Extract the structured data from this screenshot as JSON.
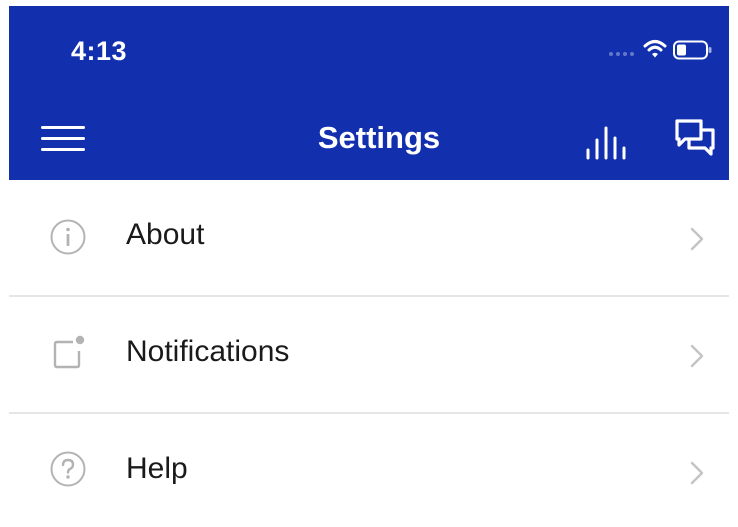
{
  "status_bar": {
    "time": "4:13",
    "signal_icon": "signal-dots-icon",
    "wifi_icon": "wifi-icon",
    "battery_icon": "battery-icon",
    "battery_level": 0.35
  },
  "nav": {
    "title": "Settings",
    "menu_icon": "hamburger-menu-icon",
    "stats_icon": "bar-chart-icon",
    "chat_icon": "chat-bubbles-icon"
  },
  "settings": {
    "items": [
      {
        "label": "About",
        "icon": "info-icon"
      },
      {
        "label": "Notifications",
        "icon": "notification-badge-icon"
      },
      {
        "label": "Help",
        "icon": "question-icon"
      }
    ]
  },
  "colors": {
    "header_bg": "#1230AD",
    "header_fg": "#FFFFFF",
    "label": "#1A1A1A",
    "icon_gray": "#B3B3B3",
    "divider": "#E6E6E6"
  }
}
